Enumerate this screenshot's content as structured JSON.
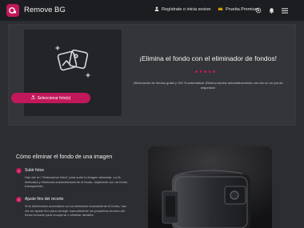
{
  "header": {
    "app_title": "Remove BG",
    "login_label": "Regístrate o inicia sesion",
    "premium_label": "Prueba Premium"
  },
  "hero": {
    "upload_button_label": "Seleccionar foto(s)",
    "title": "¡Elimina el fondo con el eliminador de fondos!",
    "description": "¡Eliminación de fondos gratis y 100 % automática! ¡Elimina fondos automáticamente con clic en un par de segundos!"
  },
  "howto": {
    "title": "Cómo eliminar el fondo de una imagen",
    "steps": [
      {
        "number": "1",
        "title": "Subir fotos",
        "text": "Haz clic en \"Seleccionar fotos\" para subir tu imagen deseada. La IA detectará y eliminará automáticamente el fondo, dejándote con un fondo transparente."
      },
      {
        "number": "2",
        "title": "Ajuste fino del recorte",
        "text": "Si la eliminación automática no ha eliminado exactamente el fondo, haz clic en ajuste fino para corregir manualmente los pequeños errores del fondo borrado para recuperar o eliminar detalles."
      }
    ]
  },
  "colors": {
    "accent": "#c2185b",
    "header_bg": "#1c1d20",
    "page_bg": "#2b2d31"
  },
  "icons": [
    "user-icon",
    "crown-icon",
    "gear-icon",
    "bell-icon",
    "menu-icon",
    "photos-icon",
    "upload-icon"
  ]
}
